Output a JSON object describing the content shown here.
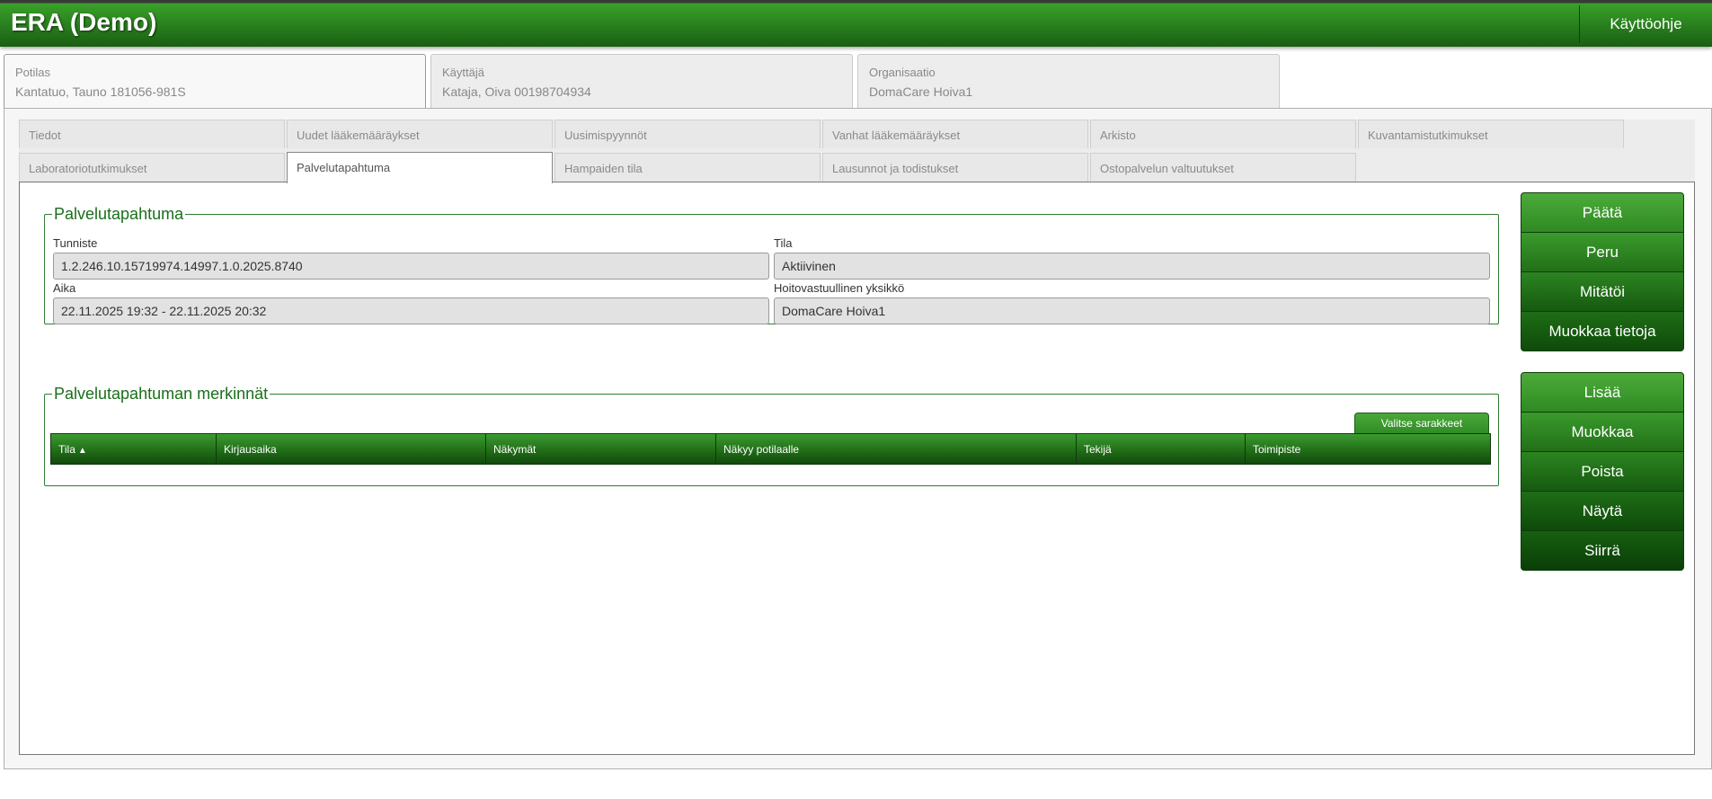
{
  "header": {
    "title": "ERA (Demo)",
    "help": "Käyttöohje"
  },
  "context_tabs": [
    {
      "label": "Potilas",
      "value": "Kantatuo, Tauno 181056-981S"
    },
    {
      "label": "Käyttäjä",
      "value": "Kataja, Oiva 00198704934"
    },
    {
      "label": "Organisaatio",
      "value": "DomaCare Hoiva1"
    }
  ],
  "sub_tabs": {
    "row1": [
      "Tiedot",
      "Uudet lääkemääräykset",
      "Uusimispyynnöt",
      "Vanhat lääkemääräykset",
      "Arkisto",
      "Kuvantamistutkimukset"
    ],
    "row2": [
      "Laboratoriotutkimukset",
      "Palvelutapahtuma",
      "Hampaiden tila",
      "Lausunnot ja todistukset",
      "Ostopalvelun valtuutukset"
    ]
  },
  "event": {
    "legend": "Palvelutapahtuma",
    "id_label": "Tunniste",
    "id_value": "1.2.246.10.15719974.14997.1.0.2025.8740",
    "state_label": "Tila",
    "state_value": "Aktiivinen",
    "time_label": "Aika",
    "time_value": "22.11.2025 19:32 - 22.11.2025 20:32",
    "unit_label": "Hoitovastuullinen yksikkö",
    "unit_value": "DomaCare Hoiva1"
  },
  "entries": {
    "legend": "Palvelutapahtuman merkinnät",
    "choose_columns": "Valitse sarakkeet",
    "columns": [
      "Tila",
      "Kirjausaika",
      "Näkymät",
      "Näkyy potilaalle",
      "Tekijä",
      "Toimipiste"
    ],
    "sort_icon": "sort-ascending-icon"
  },
  "actions_top": [
    "Päätä",
    "Peru",
    "Mitätöi",
    "Muokkaa tietoja"
  ],
  "actions_bottom": [
    "Lisää",
    "Muokkaa",
    "Poista",
    "Näytä",
    "Siirrä"
  ]
}
